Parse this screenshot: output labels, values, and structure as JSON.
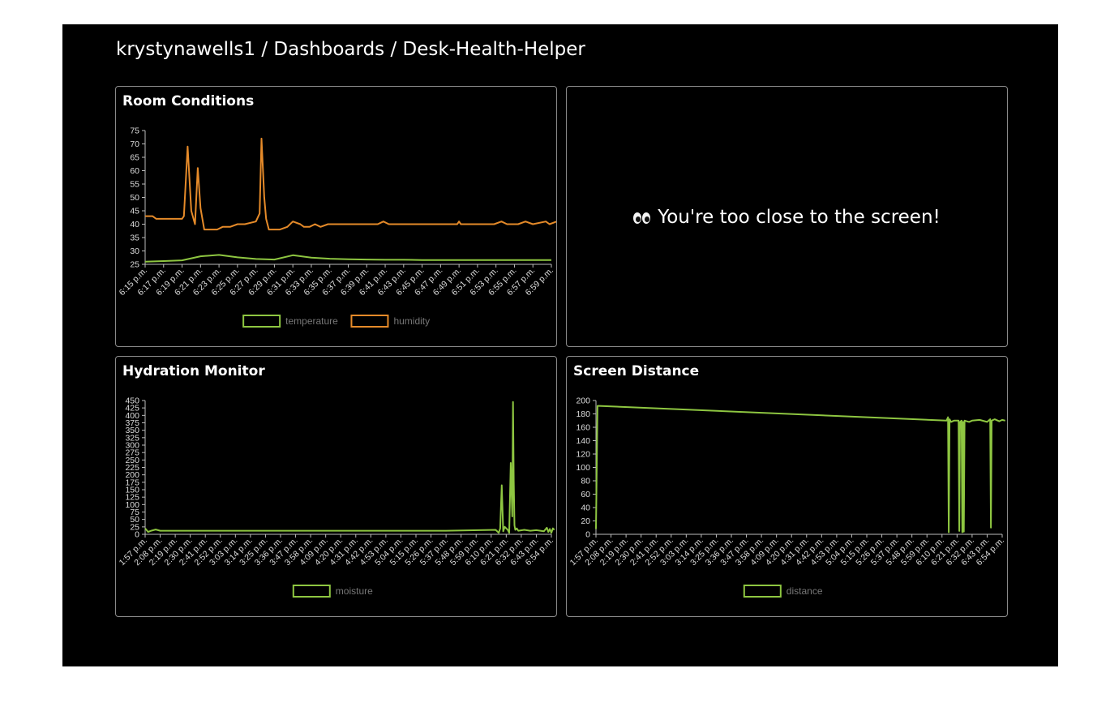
{
  "breadcrumb": "krystynawells1 / Dashboards / Desk-Health-Helper",
  "notice": {
    "icon": "eyes-emoji-icon",
    "text": "You're too close to the screen!"
  },
  "colors": {
    "temperature": "#8ec641",
    "humidity": "#e58a29",
    "moisture": "#8ec641",
    "distance": "#8ec641",
    "axis": "#bbbbbb",
    "text": "#ffffff"
  },
  "chart_data": [
    {
      "id": "room",
      "type": "line",
      "title": "Room Conditions",
      "ylim": [
        25,
        75
      ],
      "yticks": [
        25,
        30,
        35,
        40,
        45,
        50,
        55,
        60,
        65,
        70,
        75
      ],
      "x_tick_labels": [
        "6:15 p.m.",
        "6:17 p.m.",
        "6:19 p.m.",
        "6:21 p.m.",
        "6:23 p.m.",
        "6:25 p.m.",
        "6:27 p.m.",
        "6:29 p.m.",
        "6:31 p.m.",
        "6:33 p.m.",
        "6:35 p.m.",
        "6:37 p.m.",
        "6:39 p.m.",
        "6:41 p.m.",
        "6:43 p.m.",
        "6:45 p.m.",
        "6:47 p.m.",
        "6:49 p.m.",
        "6:51 p.m.",
        "6:53 p.m.",
        "6:55 p.m.",
        "6:57 p.m.",
        "6:59 p.m."
      ],
      "legend": "bottom-center",
      "series": [
        {
          "name": "temperature",
          "x": [
            0,
            1,
            2,
            3,
            4,
            5,
            6,
            7,
            8,
            9,
            10,
            11,
            12,
            13,
            14,
            15,
            16,
            17,
            18,
            19,
            20,
            21,
            22
          ],
          "y": [
            26,
            26.2,
            26.5,
            28,
            28.5,
            27.6,
            27,
            26.8,
            28.4,
            27.5,
            27.1,
            26.9,
            26.8,
            26.7,
            26.7,
            26.6,
            26.6,
            26.6,
            26.6,
            26.6,
            26.6,
            26.6,
            26.6
          ]
        },
        {
          "name": "humidity",
          "x": [
            0,
            0.4,
            0.6,
            1,
            1.5,
            2,
            2.1,
            2.3,
            2.5,
            2.7,
            2.85,
            3,
            3.2,
            3.5,
            3.9,
            4.2,
            4.6,
            5,
            5.4,
            6,
            6.2,
            6.3,
            6.45,
            6.55,
            6.7,
            7,
            7.3,
            7.7,
            8,
            8.4,
            8.6,
            8.9,
            9.2,
            9.5,
            9.9,
            10,
            10.1,
            10.3,
            11,
            12,
            12.6,
            12.9,
            13.2,
            14,
            15,
            16,
            16.9,
            17,
            17.1,
            18,
            18.9,
            19.3,
            19.6,
            20.2,
            20.6,
            21,
            21.7,
            21.9,
            22.3,
            22.6,
            22.9
          ],
          "y": [
            43,
            43,
            42,
            42,
            42,
            42,
            43,
            69,
            45,
            40,
            61,
            46,
            38,
            38,
            38,
            39,
            39,
            40,
            40,
            41,
            44,
            72,
            50,
            42,
            38,
            38,
            38,
            39,
            41,
            40,
            39,
            39,
            40,
            39,
            40,
            40,
            40,
            40,
            40,
            40,
            40,
            41,
            40,
            40,
            40,
            40,
            40,
            41,
            40,
            40,
            40,
            41,
            40,
            40,
            41,
            40,
            41,
            40,
            41,
            43,
            41
          ]
        }
      ]
    },
    {
      "id": "hydration",
      "type": "line",
      "title": "Hydration Monitor",
      "ylim": [
        0,
        450
      ],
      "yticks": [
        0,
        25,
        50,
        75,
        100,
        125,
        150,
        175,
        200,
        225,
        250,
        275,
        300,
        325,
        350,
        375,
        400,
        425,
        450
      ],
      "x_tick_labels": [
        "1:57 p.m.",
        "2:08 p.m.",
        "2:19 p.m.",
        "2:30 p.m.",
        "2:41 p.m.",
        "2:52 p.m.",
        "3:03 p.m.",
        "3:14 p.m.",
        "3:25 p.m.",
        "3:36 p.m.",
        "3:47 p.m.",
        "3:58 p.m.",
        "4:09 p.m.",
        "4:20 p.m.",
        "4:31 p.m.",
        "4:42 p.m.",
        "4:53 p.m.",
        "5:04 p.m.",
        "5:15 p.m.",
        "5:26 p.m.",
        "5:37 p.m.",
        "5:48 p.m.",
        "5:59 p.m.",
        "6:10 p.m.",
        "6:21 p.m.",
        "6:32 p.m.",
        "6:43 p.m.",
        "6:54 p.m."
      ],
      "legend": "bottom-center",
      "series": [
        {
          "name": "moisture",
          "x": [
            0,
            0.2,
            0.4,
            0.7,
            1,
            1.5,
            3,
            10,
            20,
            23.3,
            23.5,
            23.6,
            23.7,
            23.8,
            23.9,
            24.1,
            24.2,
            24.3,
            24.4,
            24.45,
            24.5,
            24.55,
            24.6,
            24.7,
            24.8,
            25.2,
            25.6,
            26,
            26.5,
            26.7,
            26.8,
            26.9,
            27,
            27.1,
            27.2
          ],
          "y": [
            20,
            8,
            12,
            16,
            12,
            12,
            12,
            12,
            12,
            15,
            5,
            20,
            165,
            10,
            25,
            15,
            5,
            240,
            60,
            445,
            180,
            30,
            15,
            20,
            12,
            15,
            12,
            14,
            10,
            22,
            8,
            18,
            5,
            20,
            15
          ]
        }
      ]
    },
    {
      "id": "distance",
      "type": "line",
      "title": "Screen Distance",
      "ylim": [
        0,
        200
      ],
      "yticks": [
        0,
        20,
        40,
        60,
        80,
        100,
        120,
        140,
        160,
        180,
        200
      ],
      "x_tick_labels": [
        "1:57 p.m.",
        "2:08 p.m.",
        "2:19 p.m.",
        "2:30 p.m.",
        "2:41 p.m.",
        "2:52 p.m.",
        "3:03 p.m.",
        "3:14 p.m.",
        "3:25 p.m.",
        "3:36 p.m.",
        "3:47 p.m.",
        "3:58 p.m.",
        "4:09 p.m.",
        "4:20 p.m.",
        "4:31 p.m.",
        "4:42 p.m.",
        "4:53 p.m.",
        "5:04 p.m.",
        "5:15 p.m.",
        "5:26 p.m.",
        "5:37 p.m.",
        "5:48 p.m.",
        "5:59 p.m.",
        "6:10 p.m.",
        "6:21 p.m.",
        "6:32 p.m.",
        "6:43 p.m.",
        "6:54 p.m."
      ],
      "legend": "bottom-center",
      "series": [
        {
          "name": "distance",
          "x": [
            0,
            0.1,
            0.2,
            23.3,
            23.4,
            23.45,
            23.5,
            23.6,
            23.8,
            24.1,
            24.15,
            24.2,
            24.3,
            24.35,
            24.4,
            24.45,
            24.5,
            24.8,
            25,
            25.5,
            26,
            26.2,
            26.25,
            26.3,
            26.5,
            26.8,
            27,
            27.2
          ],
          "y": [
            8,
            192,
            192,
            170,
            175,
            3,
            172,
            168,
            170,
            170,
            5,
            168,
            170,
            3,
            168,
            4,
            170,
            168,
            170,
            171,
            168,
            172,
            10,
            170,
            172,
            169,
            171,
            170
          ]
        }
      ]
    }
  ]
}
